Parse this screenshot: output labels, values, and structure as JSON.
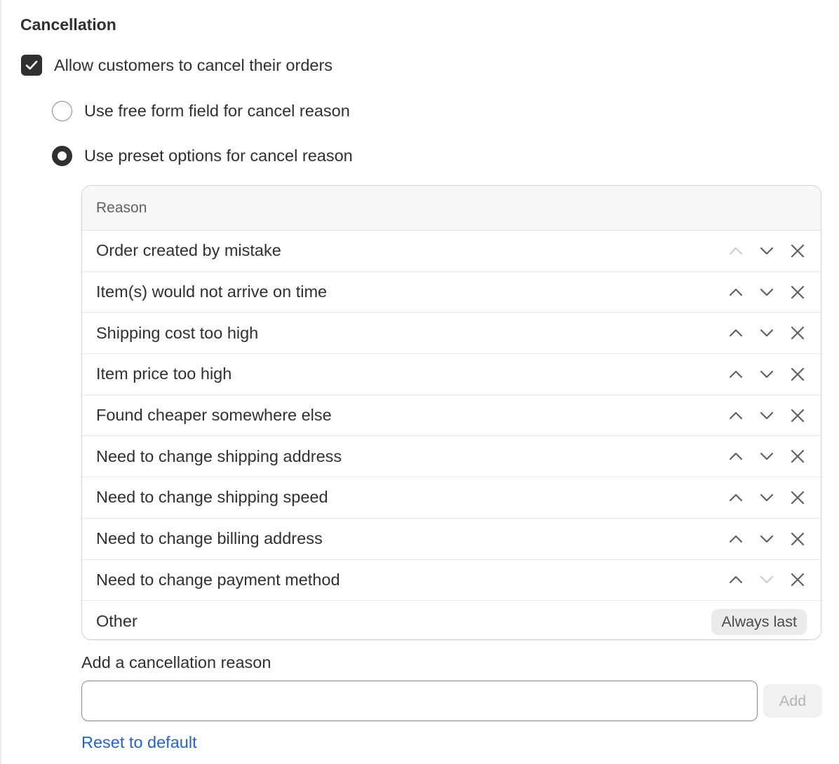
{
  "section": {
    "title": "Cancellation"
  },
  "allow_cancel": {
    "label": "Allow customers to cancel their orders",
    "checked": true
  },
  "reason_mode": {
    "free_form": {
      "label": "Use free form field for cancel reason",
      "selected": false
    },
    "preset": {
      "label": "Use preset options for cancel reason",
      "selected": true
    }
  },
  "reasons_table": {
    "header": "Reason",
    "rows": [
      {
        "label": "Order created by mistake",
        "up_enabled": false,
        "down_enabled": true
      },
      {
        "label": "Item(s) would not arrive on time",
        "up_enabled": true,
        "down_enabled": true
      },
      {
        "label": "Shipping cost too high",
        "up_enabled": true,
        "down_enabled": true
      },
      {
        "label": "Item price too high",
        "up_enabled": true,
        "down_enabled": true
      },
      {
        "label": "Found cheaper somewhere else",
        "up_enabled": true,
        "down_enabled": true
      },
      {
        "label": "Need to change shipping address",
        "up_enabled": true,
        "down_enabled": true
      },
      {
        "label": "Need to change shipping speed",
        "up_enabled": true,
        "down_enabled": true
      },
      {
        "label": "Need to change billing address",
        "up_enabled": true,
        "down_enabled": true
      },
      {
        "label": "Need to change payment method",
        "up_enabled": true,
        "down_enabled": false
      }
    ],
    "last_row": {
      "label": "Other",
      "badge": "Always last"
    }
  },
  "add_reason": {
    "label": "Add a cancellation reason",
    "value": "",
    "placeholder": "",
    "button": "Add"
  },
  "reset": {
    "label": "Reset to default"
  },
  "colors": {
    "text": "#303030",
    "link": "#2463d1",
    "icon_enabled": "#616161",
    "icon_disabled": "#cccccc"
  }
}
